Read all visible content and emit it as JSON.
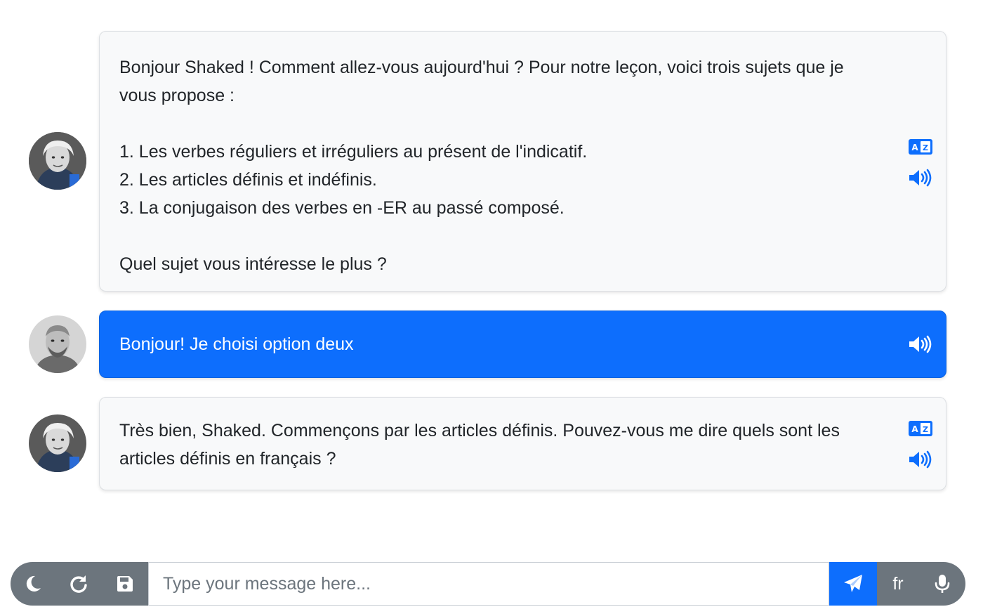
{
  "colors": {
    "accent": "#0d6efd",
    "bot_bubble_bg": "#f8f9fa",
    "bar_bg": "#6c757d"
  },
  "messages": [
    {
      "sender": "tutor",
      "lines": [
        "Bonjour Shaked ! Comment allez-vous aujourd'hui ? Pour notre leçon, voici trois sujets que je",
        "vous propose :",
        "",
        "1. Les verbes réguliers et irréguliers au présent de l'indicatif.",
        "2. Les articles définis et indéfinis.",
        "3. La conjugaison des verbes en -ER au passé composé.",
        "",
        "Quel sujet vous intéresse le plus ?"
      ],
      "icons": [
        "translate-icon",
        "speaker-icon"
      ]
    },
    {
      "sender": "user",
      "lines": [
        "Bonjour! Je choisi option deux"
      ],
      "icons": [
        "speaker-icon"
      ]
    },
    {
      "sender": "tutor",
      "lines": [
        "Très bien, Shaked. Commençons par les articles définis. Pouvez-vous me dire quels sont les",
        "articles définis en français ?"
      ],
      "icons": [
        "translate-icon",
        "speaker-icon"
      ]
    }
  ],
  "input": {
    "placeholder": "Type your message here...",
    "value": "",
    "language": "fr"
  },
  "toolbar": {
    "icons": [
      "moon-icon",
      "refresh-icon",
      "save-icon",
      "send-icon",
      "microphone-icon"
    ]
  }
}
